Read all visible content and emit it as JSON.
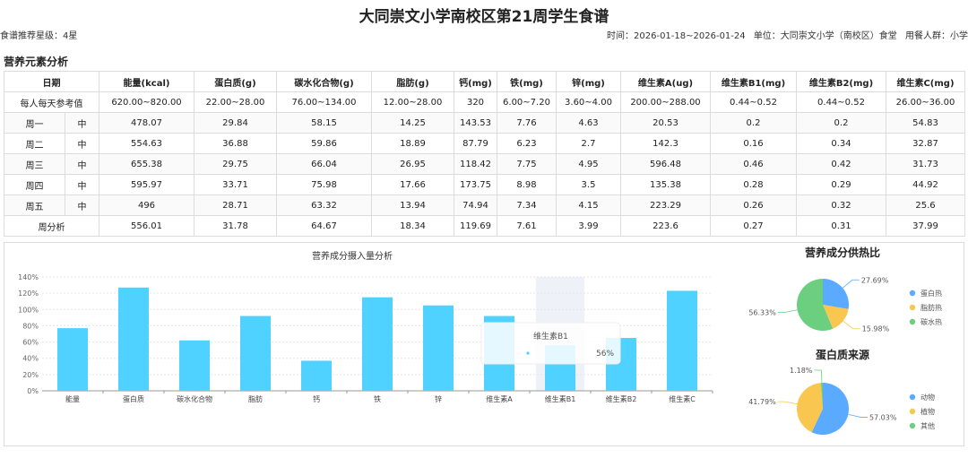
{
  "header": {
    "title": "大同崇文小学南校区第21周学生食谱",
    "rating": "食谱推荐星级：4星",
    "time": "时间：2026-01-18~2026-01-24",
    "unit": "单位：大同崇文小学（南校区）食堂",
    "audience": "用餐人群：小学"
  },
  "section_title": "营养元素分析",
  "table": {
    "date_header": "日期",
    "columns": [
      "能量(kcal)",
      "蛋白质(g)",
      "碳水化合物(g)",
      "脂肪(g)",
      "钙(mg)",
      "铁(mg)",
      "锌(mg)",
      "维生素A(ug)",
      "维生素B1(mg)",
      "维生素B2(mg)",
      "维生素C(mg)"
    ],
    "reference": {
      "label": "每人每天参考值",
      "values": [
        "620.00~820.00",
        "22.00~28.00",
        "76.00~134.00",
        "12.00~28.00",
        "320",
        "6.00~7.20",
        "3.60~4.00",
        "200.00~288.00",
        "0.44~0.52",
        "0.44~0.52",
        "26.00~36.00"
      ]
    },
    "days": [
      {
        "day": "周一",
        "meal": "中",
        "values": [
          "478.07",
          "29.84",
          "58.15",
          "14.25",
          "143.53",
          "7.76",
          "4.63",
          "20.53",
          "0.2",
          "0.2",
          "54.83"
        ]
      },
      {
        "day": "周二",
        "meal": "中",
        "values": [
          "554.63",
          "36.88",
          "59.86",
          "18.89",
          "87.79",
          "6.23",
          "2.7",
          "142.3",
          "0.16",
          "0.34",
          "32.87"
        ]
      },
      {
        "day": "周三",
        "meal": "中",
        "values": [
          "655.38",
          "29.75",
          "66.04",
          "26.95",
          "118.42",
          "7.75",
          "4.95",
          "596.48",
          "0.46",
          "0.42",
          "31.73"
        ]
      },
      {
        "day": "周四",
        "meal": "中",
        "values": [
          "595.97",
          "33.71",
          "75.98",
          "17.66",
          "173.75",
          "8.98",
          "3.5",
          "135.38",
          "0.28",
          "0.29",
          "44.92"
        ]
      },
      {
        "day": "周五",
        "meal": "中",
        "values": [
          "496",
          "28.71",
          "63.32",
          "13.94",
          "74.94",
          "7.34",
          "4.15",
          "223.29",
          "0.26",
          "0.32",
          "25.6"
        ]
      }
    ],
    "summary": {
      "label": "周分析",
      "values": [
        "556.01",
        "31.78",
        "64.67",
        "18.34",
        "119.69",
        "7.61",
        "3.99",
        "223.6",
        "0.27",
        "0.31",
        "37.99"
      ]
    }
  },
  "chart_data": [
    {
      "type": "bar",
      "title": "营养成分摄入量分析",
      "categories": [
        "能量",
        "蛋白质",
        "碳水化合物",
        "脂肪",
        "钙",
        "铁",
        "锌",
        "维生素A",
        "维生素B1",
        "维生素B2",
        "维生素C"
      ],
      "values": [
        77,
        127,
        62,
        92,
        37,
        115,
        105,
        92,
        56,
        65,
        123
      ],
      "y_unit": "%",
      "ylim": [
        0,
        140
      ],
      "yticks": [
        0,
        20,
        40,
        60,
        80,
        100,
        120,
        140
      ],
      "color": "#4fd2ff",
      "tooltip": {
        "category": "维生素B1",
        "value": "56%"
      },
      "grid": true
    },
    {
      "type": "pie",
      "title": "营养成分供热比",
      "labels": [
        "蛋白热",
        "脂肪热",
        "碳水热"
      ],
      "values": [
        27.69,
        15.98,
        56.33
      ],
      "value_labels": [
        "27.69%",
        "15.98%",
        "56.33%"
      ],
      "colors": [
        "#5aabff",
        "#f9c74f",
        "#6bcf7f"
      ],
      "legend": "right"
    },
    {
      "type": "pie",
      "title": "蛋白质来源",
      "labels": [
        "动物",
        "植物",
        "其他"
      ],
      "values": [
        57.03,
        41.79,
        1.18
      ],
      "value_labels": [
        "57.03%",
        "41.79%",
        "1.18%"
      ],
      "colors": [
        "#5aabff",
        "#f9c74f",
        "#6bcf7f"
      ],
      "legend": "right"
    }
  ]
}
